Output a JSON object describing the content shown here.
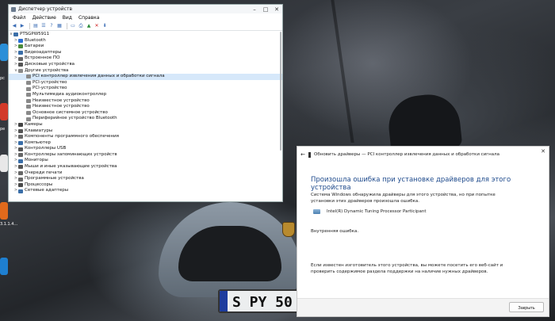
{
  "device_manager": {
    "title": "Диспетчер устройств",
    "menu": [
      "Файл",
      "Действие",
      "Вид",
      "Справка"
    ],
    "computer_name": "PTSGPW5911",
    "tree": [
      {
        "label": "Bluetooth",
        "indent": 1,
        "expander": ">",
        "icon_color": "#2b6fd6"
      },
      {
        "label": "Батареи",
        "indent": 1,
        "expander": ">",
        "icon_color": "#4a8a3a"
      },
      {
        "label": "Видеоадаптеры",
        "indent": 1,
        "expander": ">",
        "icon_color": "#3a6ea8"
      },
      {
        "label": "Встроенное ПО",
        "indent": 1,
        "expander": ">",
        "icon_color": "#666666"
      },
      {
        "label": "Дисковые устройства",
        "indent": 1,
        "expander": ">",
        "icon_color": "#555555"
      },
      {
        "label": "Другие устройства",
        "indent": 1,
        "expander": "v",
        "icon_color": "#8a8a8a"
      },
      {
        "label": "PCI контроллер извлечения данных и обработки сигнала",
        "indent": 2,
        "expander": "",
        "icon_color": "#8a8a8a",
        "selected": true
      },
      {
        "label": "PCI-устройство",
        "indent": 2,
        "expander": "",
        "icon_color": "#8a8a8a"
      },
      {
        "label": "PCI-устройство",
        "indent": 2,
        "expander": "",
        "icon_color": "#8a8a8a"
      },
      {
        "label": "Мультимедиа аудиоконтроллер",
        "indent": 2,
        "expander": "",
        "icon_color": "#8a8a8a"
      },
      {
        "label": "Неизвестное устройство",
        "indent": 2,
        "expander": "",
        "icon_color": "#8a8a8a"
      },
      {
        "label": "Неизвестное устройство",
        "indent": 2,
        "expander": "",
        "icon_color": "#8a8a8a"
      },
      {
        "label": "Основное системное устройство",
        "indent": 2,
        "expander": "",
        "icon_color": "#8a8a8a"
      },
      {
        "label": "Периферийное устройство Bluetooth",
        "indent": 2,
        "expander": "",
        "icon_color": "#8a8a8a"
      },
      {
        "label": "Камеры",
        "indent": 1,
        "expander": ">",
        "icon_color": "#444444"
      },
      {
        "label": "Клавиатуры",
        "indent": 1,
        "expander": ">",
        "icon_color": "#555555"
      },
      {
        "label": "Компоненты программного обеспечения",
        "indent": 1,
        "expander": ">",
        "icon_color": "#6a6a6a"
      },
      {
        "label": "Компьютер",
        "indent": 1,
        "expander": ">",
        "icon_color": "#3a6ea8"
      },
      {
        "label": "Контроллеры USB",
        "indent": 1,
        "expander": ">",
        "icon_color": "#555555"
      },
      {
        "label": "Контроллеры запоминающих устройств",
        "indent": 1,
        "expander": ">",
        "icon_color": "#666666"
      },
      {
        "label": "Мониторы",
        "indent": 1,
        "expander": ">",
        "icon_color": "#3a6ea8"
      },
      {
        "label": "Мыши и иные указывающие устройства",
        "indent": 1,
        "expander": ">",
        "icon_color": "#555555"
      },
      {
        "label": "Очереди печати",
        "indent": 1,
        "expander": ">",
        "icon_color": "#666666"
      },
      {
        "label": "Программные устройства",
        "indent": 1,
        "expander": ">",
        "icon_color": "#666666"
      },
      {
        "label": "Процессоры",
        "indent": 1,
        "expander": ">",
        "icon_color": "#4a4a4a"
      },
      {
        "label": "Сетевые адаптеры",
        "indent": 1,
        "expander": ">",
        "icon_color": "#3a6ea8"
      }
    ]
  },
  "dialog": {
    "header": "Обновить драйверы — PCI контроллер извлечения данных и обработки сигнала",
    "heading": "Произошла ошибка при установке драйверов для этого устройства",
    "message": "Система Windows обнаружила драйверы для этого устройства, но при попытке установки этих драйверов произошла ошибка.",
    "device_name": "Intel(R) Dynamic Tuning Processor Participant",
    "error_text": "Внутренняя ошибка.",
    "hint": "Если известен изготовитель этого устройства, вы можете посетить его веб-сайт и проверить содержимое раздела поддержки на наличие нужных драйверов.",
    "close_button": "Закрыть"
  },
  "wallpaper": {
    "plate_text": "S PY 50"
  },
  "desktop_labels": [
    "pc",
    "ре",
    "3.1.1.4..."
  ]
}
